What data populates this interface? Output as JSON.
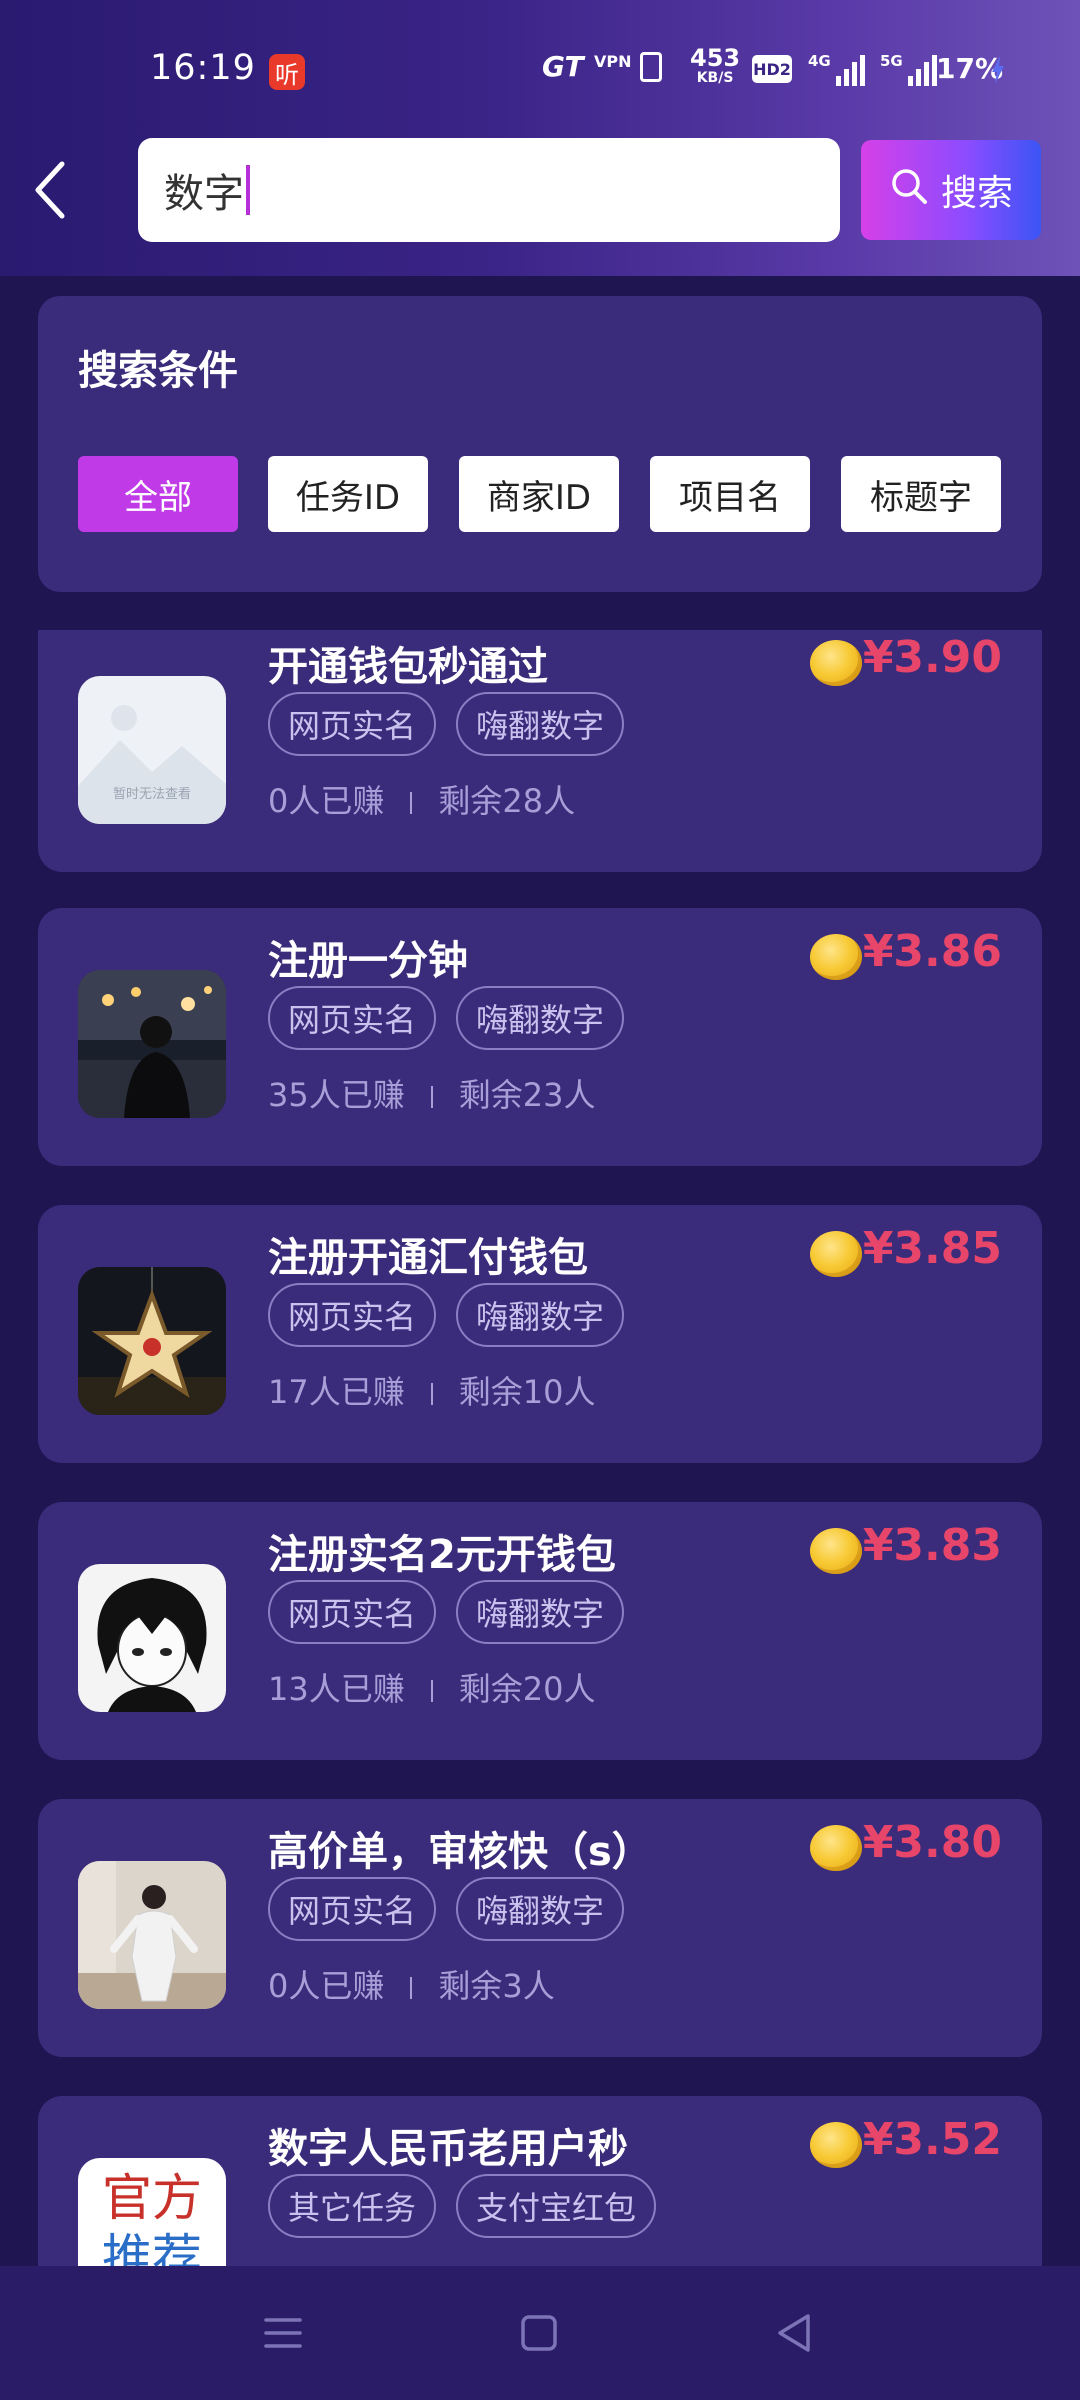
{
  "status_bar": {
    "time": "16:19",
    "app_badge": "听",
    "gt_label": "GT",
    "vpn_label": "VPN",
    "speed_value": "453",
    "speed_unit": "KB/S",
    "hd_label": "HD2",
    "net1_label": "4G",
    "net2_label": "5G",
    "battery": "17%"
  },
  "search": {
    "query": "数字",
    "button_label": "搜索"
  },
  "filter": {
    "title": "搜索条件",
    "chips": [
      "全部",
      "任务ID",
      "商家ID",
      "项目名",
      "标题字"
    ],
    "active_chip": "全部"
  },
  "tasks": [
    {
      "title": "开通钱包秒通过",
      "price": "¥3.90",
      "tags": [
        "网页实名",
        "嗨翻数字"
      ],
      "earned": "0人已赚",
      "remaining": "剩余28人",
      "thumb": "placeholder-image",
      "thumb_text": "暂时无法查看"
    },
    {
      "title": "注册一分钟",
      "price": "¥3.86",
      "tags": [
        "网页实名",
        "嗨翻数字"
      ],
      "earned": "35人已赚",
      "remaining": "剩余23人",
      "thumb": "night-street-photo"
    },
    {
      "title": "注册开通汇付钱包",
      "price": "¥3.85",
      "tags": [
        "网页实名",
        "嗨翻数字"
      ],
      "earned": "17人已赚",
      "remaining": "剩余10人",
      "thumb": "star-lantern-photo"
    },
    {
      "title": "注册实名2元开钱包",
      "price": "¥3.83",
      "tags": [
        "网页实名",
        "嗨翻数字"
      ],
      "earned": "13人已赚",
      "remaining": "剩余20人",
      "thumb": "anime-avatar"
    },
    {
      "title": "高价单，审核快（s）",
      "price": "¥3.80",
      "tags": [
        "网页实名",
        "嗨翻数字"
      ],
      "earned": "0人已赚",
      "remaining": "剩余3人",
      "thumb": "person-photo"
    },
    {
      "title": "数字人民币老用户秒",
      "price": "¥3.52",
      "tags": [
        "其它任务",
        "支付宝红包"
      ],
      "earned": "",
      "remaining": "",
      "thumb": "official-recommend",
      "thumb_text_1": "官方",
      "thumb_text_2": "推荐"
    }
  ],
  "colors": {
    "header_start": "#2a1a70",
    "card_bg": "#3a2c7a",
    "price": "#e8456a",
    "active_chip": "#c03ae8"
  },
  "nav_icons": [
    "menu-icon",
    "home-square-icon",
    "back-triangle-icon"
  ]
}
